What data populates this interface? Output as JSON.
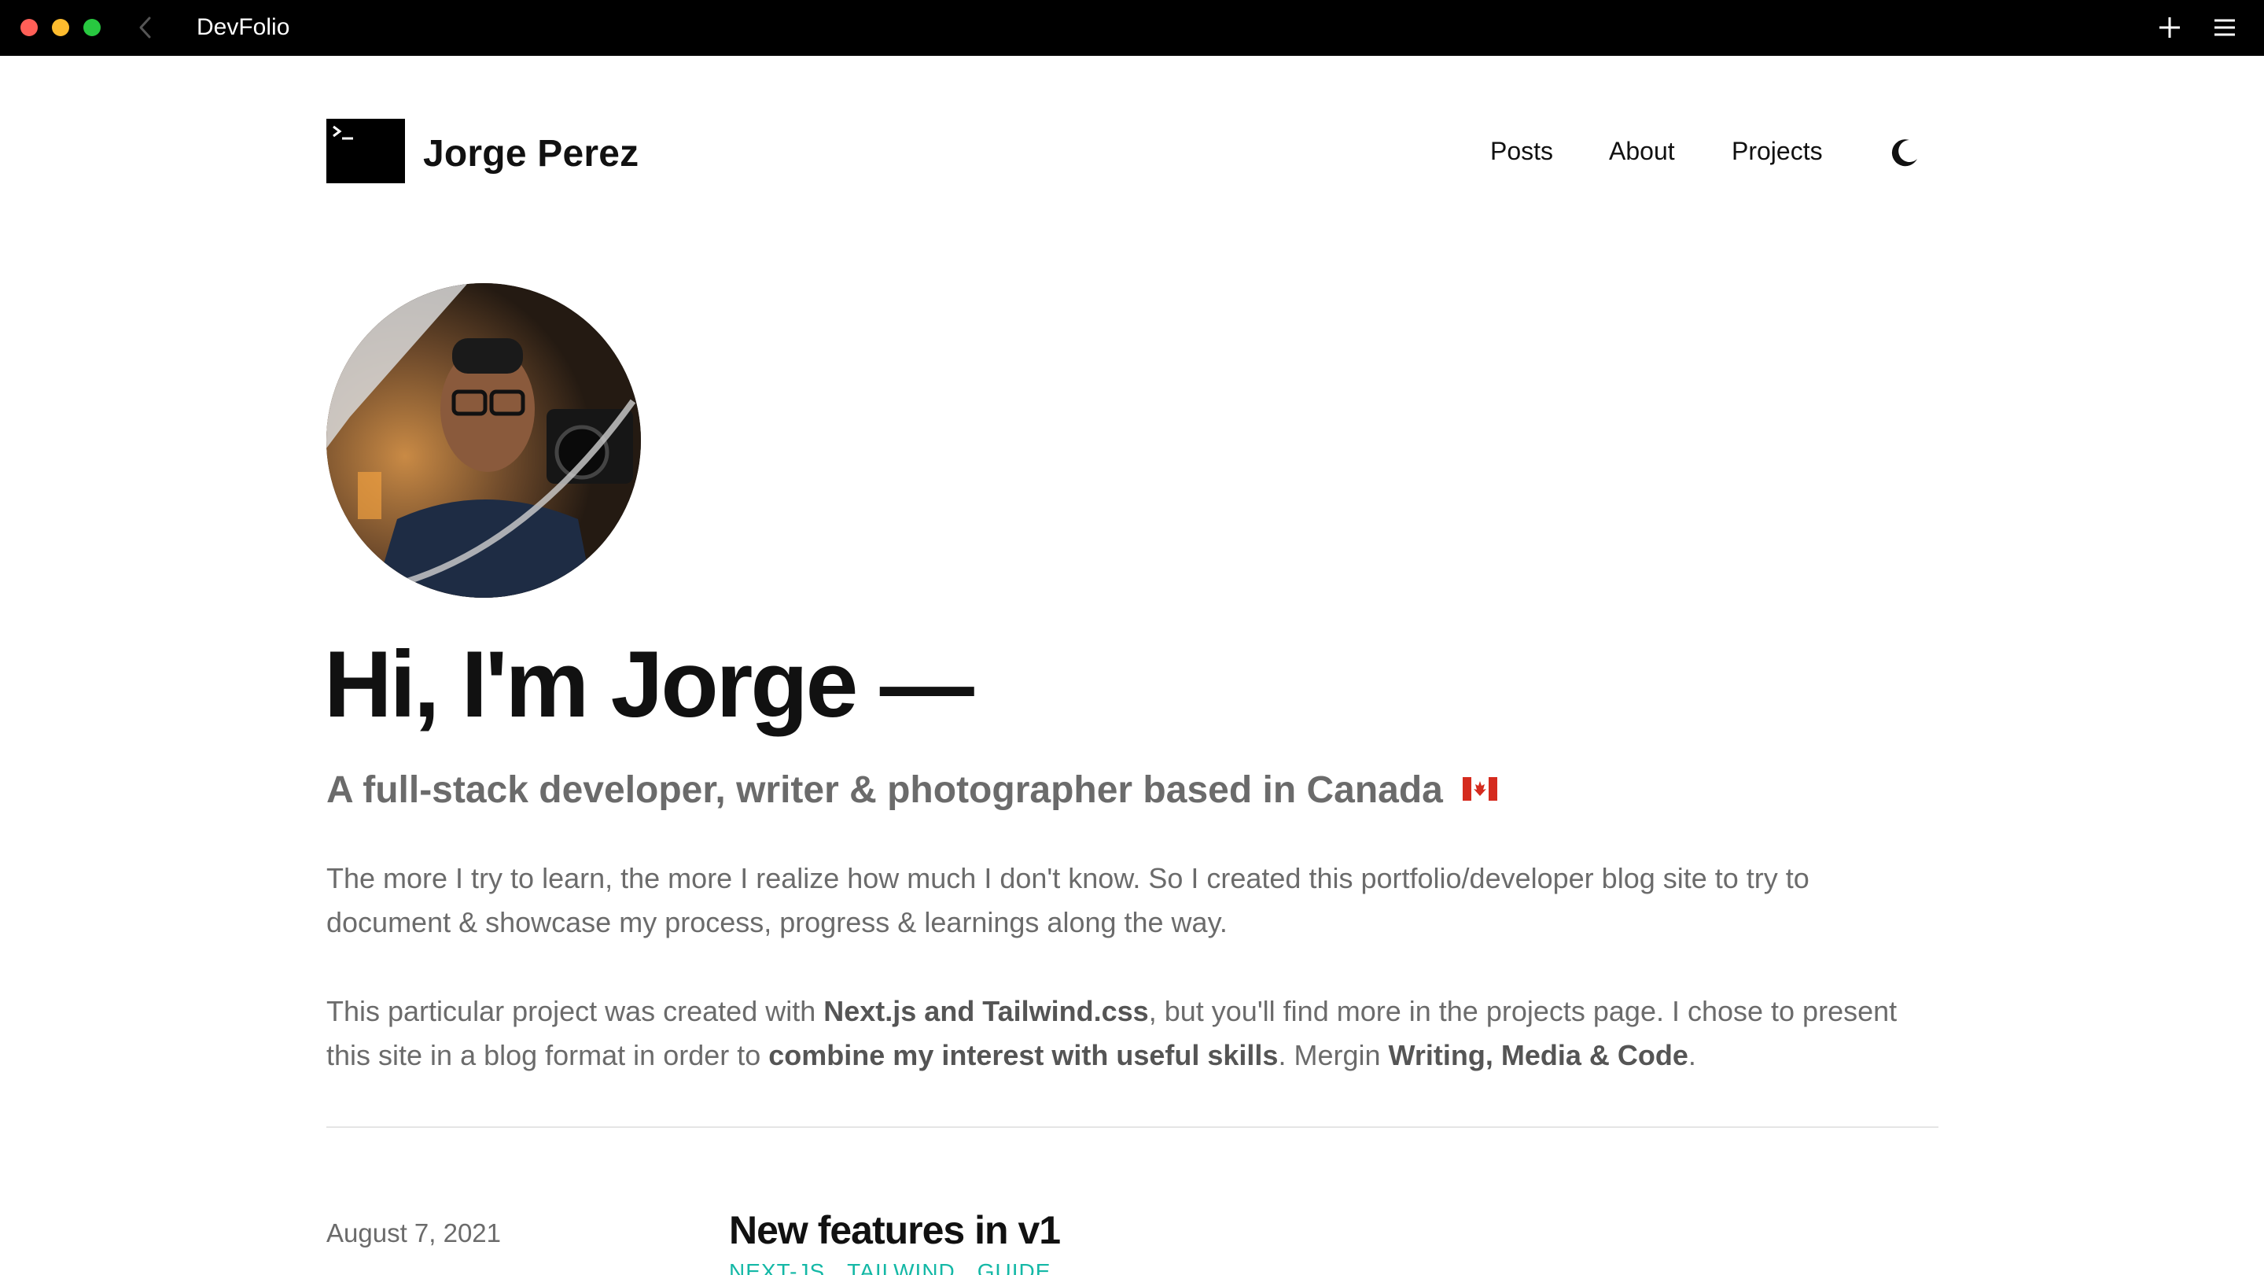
{
  "window": {
    "title": "DevFolio",
    "icons": [
      "back-icon",
      "plus-icon",
      "menu-icon"
    ]
  },
  "header": {
    "site_name": "Jorge Perez",
    "logo_icon": "terminal-icon",
    "nav": [
      {
        "label": "Posts"
      },
      {
        "label": "About"
      },
      {
        "label": "Projects"
      }
    ],
    "theme_toggle_icon": "moon-icon"
  },
  "hero": {
    "avatar_alt": "avatar",
    "title": "Hi, I'm Jorge —",
    "subtitle": "A full-stack developer, writer & photographer based in Canada",
    "flag_icon": "canada-flag-icon",
    "para1": "The more I try to learn, the more I realize how much I don't know. So I created this portfolio/developer blog site to try to document & showcase my process, progress & learnings along the way.",
    "para2": {
      "t1": "This particular project was created with ",
      "b1": "Next.js and Tailwind.css",
      "t2": ", but you'll find more in the projects page. I chose to present this site in a blog format in order to ",
      "b2": "combine my interest with useful skills",
      "t3": ". Mergin ",
      "b3": "Writing, Media & Code",
      "t4": "."
    }
  },
  "posts": [
    {
      "date": "August 7, 2021",
      "title": "New features in v1",
      "tags": [
        "NEXT-JS",
        "TAILWIND",
        "GUIDE"
      ]
    }
  ],
  "colors": {
    "accent": "#14b8a6",
    "text": "#111111",
    "muted": "#6b6b6b",
    "titlebar": "#000000"
  }
}
